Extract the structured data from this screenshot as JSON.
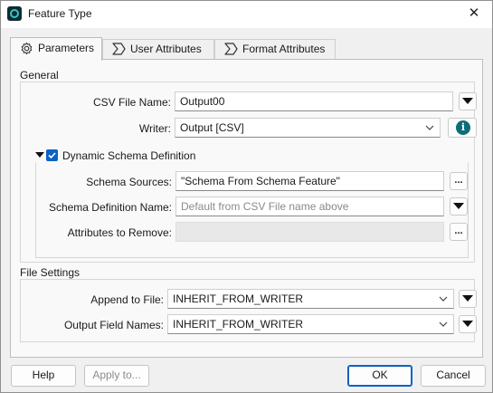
{
  "window": {
    "title": "Feature Type",
    "close_glyph": "✕"
  },
  "tabs": [
    {
      "label": "Parameters",
      "icon": "gear-icon"
    },
    {
      "label": "User Attributes",
      "icon": "sigma-icon"
    },
    {
      "label": "Format Attributes",
      "icon": "sigma-icon"
    }
  ],
  "general": {
    "title": "General",
    "csv_file_name": {
      "label": "CSV File Name:",
      "value": "Output00"
    },
    "writer": {
      "label": "Writer:",
      "value": "Output [CSV]"
    },
    "dynamic_schema": {
      "label": "Dynamic Schema Definition",
      "checked": true,
      "schema_sources": {
        "label": "Schema Sources:",
        "value": "\"Schema From Schema Feature\"",
        "button": "..."
      },
      "schema_definition_name": {
        "label": "Schema Definition Name:",
        "placeholder": "Default from CSV File name above"
      },
      "attributes_to_remove": {
        "label": "Attributes to Remove:",
        "value": "",
        "button": "..."
      }
    }
  },
  "file_settings": {
    "title": "File Settings",
    "append_to_file": {
      "label": "Append to File:",
      "value": "INHERIT_FROM_WRITER"
    },
    "output_field_names": {
      "label": "Output Field Names:",
      "value": "INHERIT_FROM_WRITER"
    }
  },
  "footer": {
    "help": "Help",
    "apply": "Apply to...",
    "ok": "OK",
    "cancel": "Cancel"
  },
  "colors": {
    "accent": "#0b62c4",
    "info": "#0d6e7a"
  }
}
